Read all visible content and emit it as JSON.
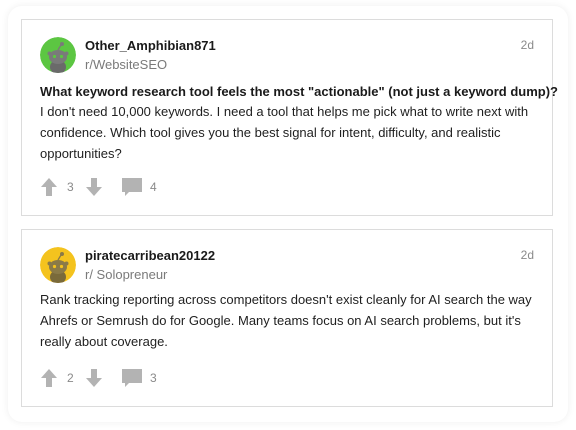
{
  "colors": {
    "avatar_green": "#5cc642",
    "avatar_yellow": "#f4c31e",
    "icon_gray": "#b3b3b3",
    "text_primary": "#1a1a1a",
    "text_secondary": "#7a7a7a"
  },
  "posts": [
    {
      "avatar_icon": "reddit-snoo-avatar-green",
      "username": "Other_Amphibian871",
      "subreddit": "r/WebsiteSEO",
      "timestamp": "2d",
      "title": "What keyword research tool feels the most \"actionable\" (not just a keyword dump)?",
      "body": "I don't need 10,000 keywords. I need a tool that helps me pick what to write next with confidence. Which tool gives you the best signal for intent, difficulty, and realistic opportunities?",
      "upvotes": "3",
      "comments": "4"
    },
    {
      "avatar_icon": "reddit-snoo-avatar-yellow",
      "username": "piratecarribean20122",
      "subreddit": "r/ Solopreneur",
      "timestamp": "2d",
      "title": "",
      "body": "Rank tracking reporting across competitors doesn't exist cleanly for AI search the way Ahrefs or Semrush do for Google. Many teams focus on AI search problems, but it's really about coverage.",
      "upvotes": "2",
      "comments": "3"
    }
  ]
}
